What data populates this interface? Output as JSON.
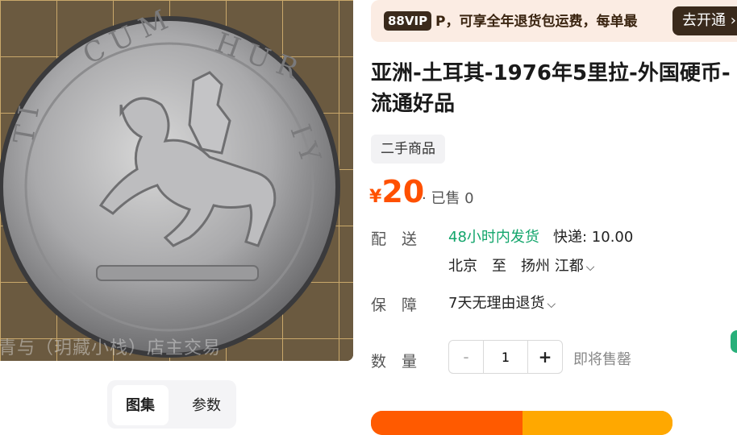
{
  "gallery": {
    "watermark": "青与（玥藏小栈）店主交易",
    "tabs": [
      {
        "label": "图集",
        "active": true
      },
      {
        "label": "参数",
        "active": false
      }
    ]
  },
  "vip_banner": {
    "badge": "88VIP",
    "text": "P，可享全年退货包运费，每单最",
    "button": "去开通 ›"
  },
  "product": {
    "title_line1": "亚洲-土耳其-1976年5里拉-外国硬币-",
    "title_line2": "流通好品",
    "condition_tag": "二手商品",
    "currency": "¥",
    "price": "20",
    "sold": "· 已售 0"
  },
  "shipping": {
    "label": "配　送",
    "fast": "48小时内发货",
    "fee": "快递: 10.00",
    "route": "北京　至　扬州 江都"
  },
  "guarantee": {
    "label": "保　障",
    "value": "7天无理由退货"
  },
  "quantity": {
    "label": "数　量",
    "minus": "-",
    "value": "1",
    "plus": "+",
    "stock_note": "即将售罄"
  },
  "colors": {
    "price": "#ff5000",
    "shipping_fast": "#12a56b",
    "vip_dark": "#3a2a1c"
  }
}
